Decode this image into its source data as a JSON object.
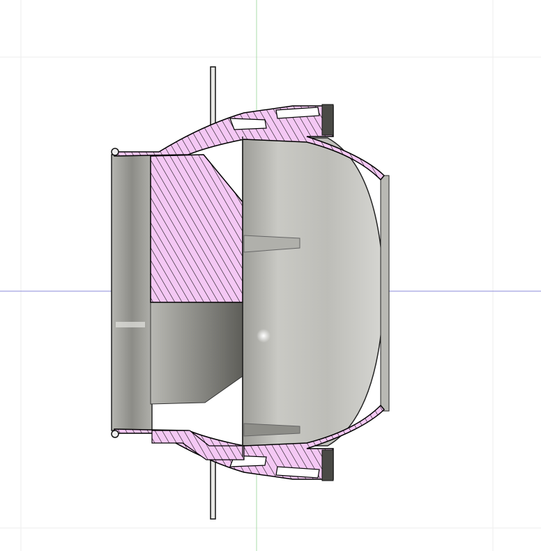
{
  "viewport": {
    "background": "#ffffff",
    "grid_color": "#eeeeee",
    "x_axis_color": "#8a8ad8",
    "y_axis_color": "#a8dca8"
  },
  "model": {
    "section_hatch_fill": "#f4c8f4",
    "section_hatch_line": "#000000",
    "body_shade_light": "#c8c8c4",
    "body_shade_mid": "#a9a9a4",
    "body_shade_dark": "#6e6e69",
    "outline_color": "#111111"
  }
}
